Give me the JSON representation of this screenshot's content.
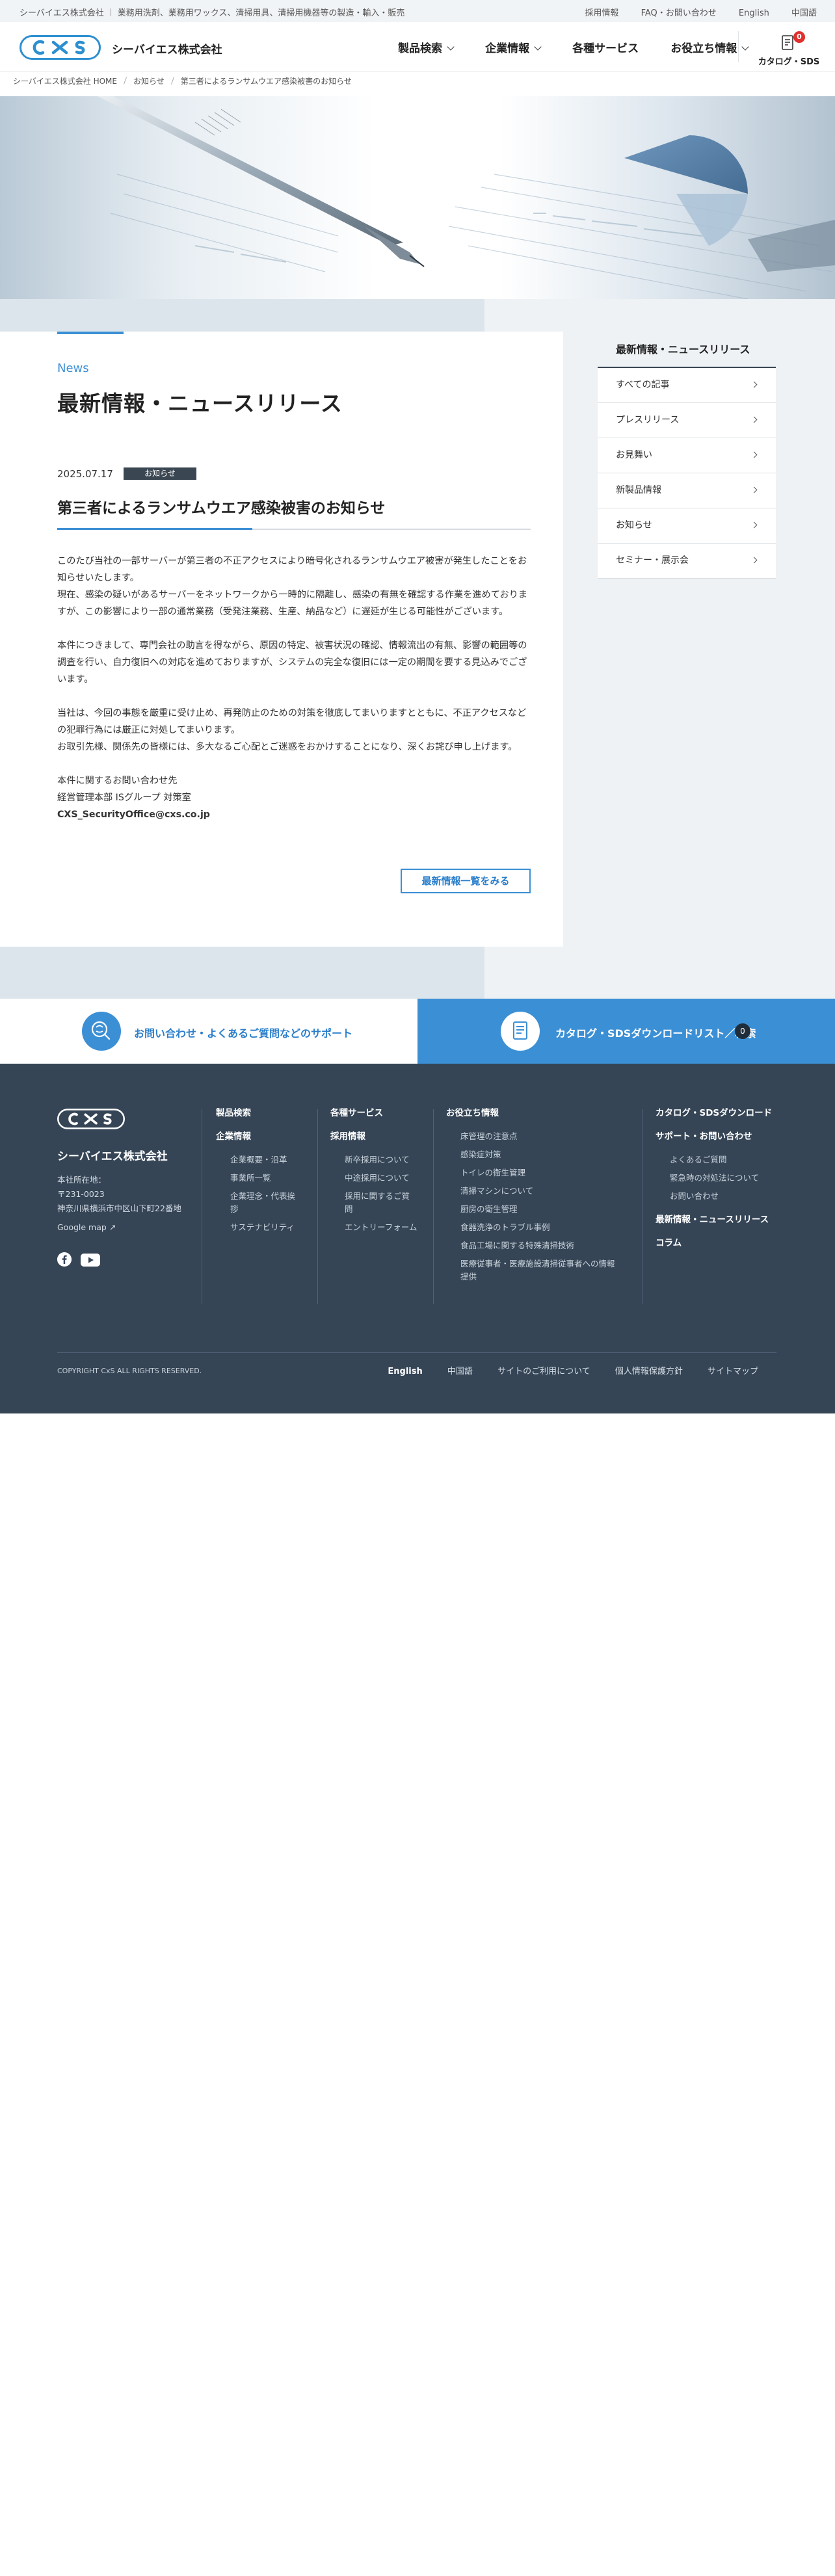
{
  "topbar": {
    "company": "シーバイエス株式会社",
    "tagline": "業務用洗剤、業務用ワックス、清掃用具、清掃用機器等の製造・輸入・販売",
    "links": [
      "採用情報",
      "FAQ・お問い合わせ",
      "English",
      "中国語"
    ]
  },
  "header": {
    "logo_text": "CxS",
    "company_name": "シーバイエス株式会社",
    "nav": [
      {
        "label": "製品検索",
        "dropdown": true
      },
      {
        "label": "企業情報",
        "dropdown": true
      },
      {
        "label": "各種サービス",
        "dropdown": false
      },
      {
        "label": "お役立ち情報",
        "dropdown": true
      }
    ],
    "catalog_label": "カタログ・SDS",
    "catalog_count": "0"
  },
  "breadcrumb": [
    "シーバイエス株式会社 HOME",
    "お知らせ",
    "第三者によるランサムウエア感染被害のお知らせ"
  ],
  "main": {
    "eyebrow": "News",
    "title": "最新情報・ニュースリリース",
    "date": "2025.07.17",
    "category": "お知らせ",
    "post_title": "第三者によるランサムウエア感染被害のお知らせ",
    "paragraphs": [
      "このたび当社の一部サーバーが第三者の不正アクセスにより暗号化されるランサムウエア被害が発生したことをお知らせいたします。",
      "現在、感染の疑いがあるサーバーをネットワークから一時的に隔離し、感染の有無を確認する作業を進めておりますが、この影響により一部の通常業務（受発注業務、生産、納品など）に遅延が生じる可能性がございます。",
      "本件につきまして、専門会社の助言を得ながら、原因の特定、被害状況の確認、情報流出の有無、影響の範囲等の調査を行い、自力復旧への対応を進めておりますが、システムの完全な復旧には一定の期間を要する見込みでございます。",
      "当社は、今回の事態を厳重に受け止め、再発防止のための対策を徹底してまいりますとともに、不正アクセスなどの犯罪行為には厳正に対処してまいります。",
      "お取引先様、関係先の皆様には、多大なるご心配とご迷惑をおかけすることになり、深くお詫び申し上げます。"
    ],
    "contact_heading": "本件に関するお問い合わせ先",
    "contact_dept": "経営管理本部 ISグループ 対策室",
    "contact_email": "CXS_SecurityOffice@cxs.co.jp",
    "more_button": "最新情報一覧をみる"
  },
  "sidebar": {
    "heading": "最新情報・ニュースリリース",
    "items": [
      "すべての記事",
      "プレスリリース",
      "お見舞い",
      "新製品情報",
      "お知らせ",
      "セミナー・展示会"
    ]
  },
  "support": {
    "left_label": "お問い合わせ・よくあるご質問などのサポート",
    "right_label": "カタログ・SDSダウンロードリスト／検索",
    "right_count": "0"
  },
  "footer": {
    "logo_text": "CxS",
    "company_name": "シーバイエス株式会社",
    "address_label": "本社所在地：",
    "postal": "〒231-0023",
    "address": "神奈川県横浜市中区山下町22番地",
    "gmap": "Google map",
    "col1": {
      "h1": "製品検索",
      "h2": "企業情報",
      "items": [
        "企業概要・沿革",
        "事業所一覧",
        "企業理念・代表挨拶",
        "サステナビリティ"
      ]
    },
    "col2": {
      "h1": "各種サービス",
      "h2": "採用情報",
      "items": [
        "新卒採用について",
        "中途採用について",
        "採用に関するご質問",
        "エントリーフォーム"
      ]
    },
    "col3": {
      "h1": "お役立ち情報",
      "items": [
        "床管理の注意点",
        "感染症対策",
        "トイレの衛生管理",
        "清掃マシンについて",
        "厨房の衛生管理",
        "食器洗浄のトラブル事例",
        "食品工場に関する特殊清掃技術",
        "医療従事者・医療施設清掃従事者への情報提供"
      ]
    },
    "col4": {
      "h1": "カタログ・SDSダウンロード",
      "h2": "サポート・お問い合わせ",
      "items": [
        "よくあるご質問",
        "緊急時の対処法について",
        "お問い合わせ"
      ],
      "h3": "最新情報・ニュースリリース",
      "h4": "コラム"
    },
    "copyright": "COPYRIGHT CxS ALL RIGHTS RESERVED.",
    "links": [
      "English",
      "中国語",
      "サイトのご利用について",
      "個人情報保護方針",
      "サイトマップ"
    ]
  },
  "colors": {
    "accent": "#3b8fd5",
    "footer_bg": "#354556",
    "badge_red": "#e0302e"
  }
}
